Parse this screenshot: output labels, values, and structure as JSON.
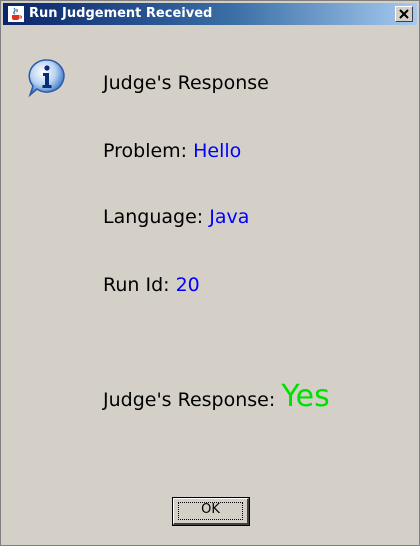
{
  "window": {
    "title": "Run Judgement Received",
    "icon": "java-cup-icon",
    "close_icon": "close-icon"
  },
  "dialog": {
    "icon": "info-icon",
    "heading": "Judge's Response",
    "problem_label": "Problem:",
    "problem_value": "Hello",
    "language_label": "Language:",
    "language_value": "Java",
    "run_id_label": "Run Id:",
    "run_id_value": "20",
    "response_label": "Judge's Response:",
    "response_value": "Yes",
    "ok_label": "OK"
  },
  "colors": {
    "value_blue": "#0000ff",
    "yes_green": "#00e000",
    "titlebar_start": "#0a246a",
    "background": "#d4d0c8"
  }
}
